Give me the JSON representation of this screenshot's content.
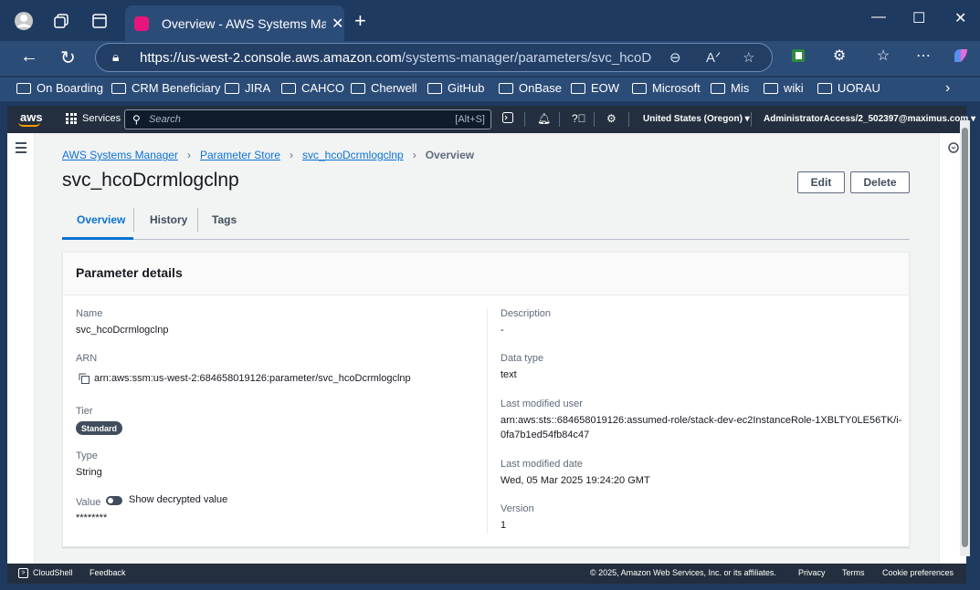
{
  "browser": {
    "tab_title": "Overview - AWS Systems Manage",
    "url_host": "https://us-west-2.console.aws.amazon.com",
    "url_path": "/systems-manager/parameters/svc_hcoDcrml...",
    "bookmarks": [
      "On Boarding",
      "CRM Beneficiary",
      "JIRA",
      "CAHCO",
      "Cherwell",
      "GitHub",
      "OnBase",
      "EOW",
      "Microsoft",
      "Mis",
      "wiki",
      "UORAU"
    ]
  },
  "awsnav": {
    "logo": "aws",
    "services": "Services",
    "search_placeholder": "Search",
    "search_shortcut": "[Alt+S]",
    "region": "United States (Oregon) ▾",
    "account": "AdministratorAccess/2_502397@maximus.com ▾"
  },
  "breadcrumb": {
    "items": [
      "AWS Systems Manager",
      "Parameter Store",
      "svc_hcoDcrmlogclnp"
    ],
    "current": "Overview"
  },
  "page": {
    "title": "svc_hcoDcrmlogclnp",
    "edit_label": "Edit",
    "delete_label": "Delete"
  },
  "tabs": [
    "Overview",
    "History",
    "Tags"
  ],
  "details": {
    "heading": "Parameter details",
    "name_label": "Name",
    "name_value": "svc_hcoDcrmlogclnp",
    "arn_label": "ARN",
    "arn_value": "arn:aws:ssm:us-west-2:684658019126:parameter/svc_hcoDcrmlogclnp",
    "tier_label": "Tier",
    "tier_value": "Standard",
    "type_label": "Type",
    "type_value": "String",
    "value_label": "Value",
    "decrypt_label": "Show decrypted value",
    "value_masked": "********",
    "description_label": "Description",
    "description_value": "-",
    "datatype_label": "Data type",
    "datatype_value": "text",
    "modified_user_label": "Last modified user",
    "modified_user_line1": "arn:aws:sts::684658019126:assumed-role/stack-dev-ec2InstanceRole-1XBLTY0LE56TK/i-",
    "modified_user_line2": "0fa7b1ed54fb84c47",
    "modified_date_label": "Last modified date",
    "modified_date_value": "Wed, 05 Mar 2025 19:24:20 GMT",
    "version_label": "Version",
    "version_value": "1"
  },
  "footer": {
    "cloudshell": "CloudShell",
    "feedback": "Feedback",
    "copyright": "© 2025, Amazon Web Services, Inc. or its affiliates.",
    "privacy": "Privacy",
    "terms": "Terms",
    "cookies": "Cookie preferences"
  }
}
